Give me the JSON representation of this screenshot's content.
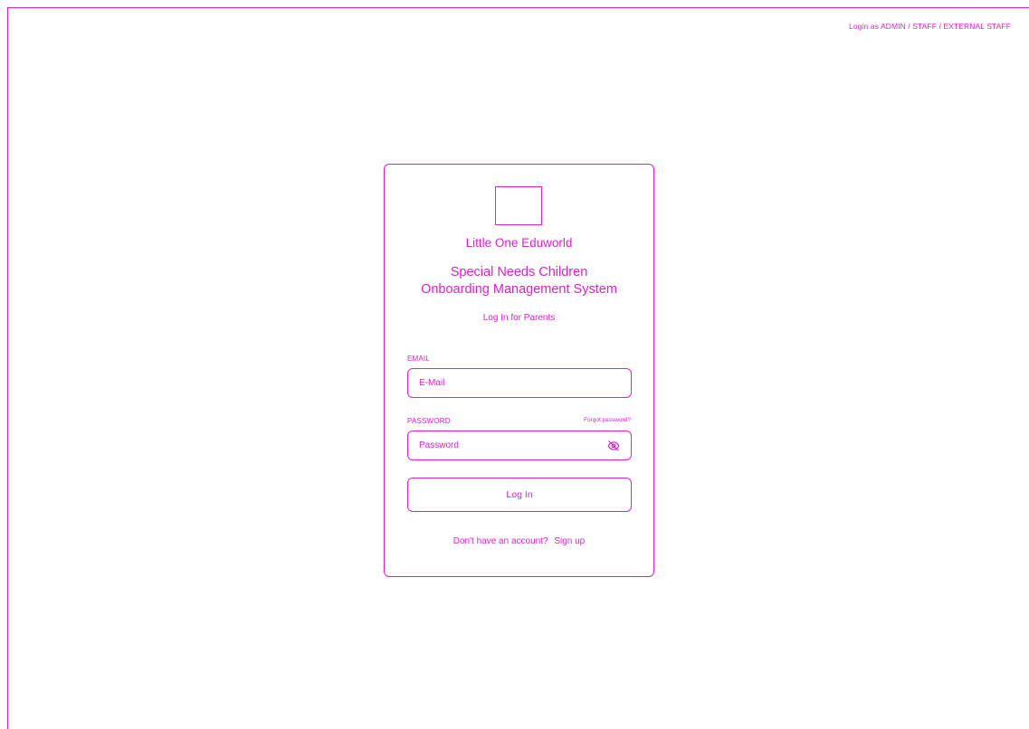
{
  "header": {
    "staff_login_link": "Login as ADMIN / STAFF / EXTERNAL STAFF"
  },
  "card": {
    "org_name": "Little One Eduworld",
    "system_title_line1": "Special Needs Children",
    "system_title_line2": "Onboarding Management System",
    "subtitle": "Log In for Parents"
  },
  "form": {
    "email_label": "EMAIL",
    "email_placeholder": "E-Mail",
    "password_label": "PASSWORD",
    "forgot_password": "Forgot password?",
    "password_placeholder": "Password",
    "password_icon": "eye-off-icon",
    "login_button": "Log In"
  },
  "footer": {
    "no_account_text": "Don't have an account?",
    "signup_link": "Sign up"
  },
  "colors": {
    "accent": "#e020c8",
    "background": "#ffffff"
  }
}
